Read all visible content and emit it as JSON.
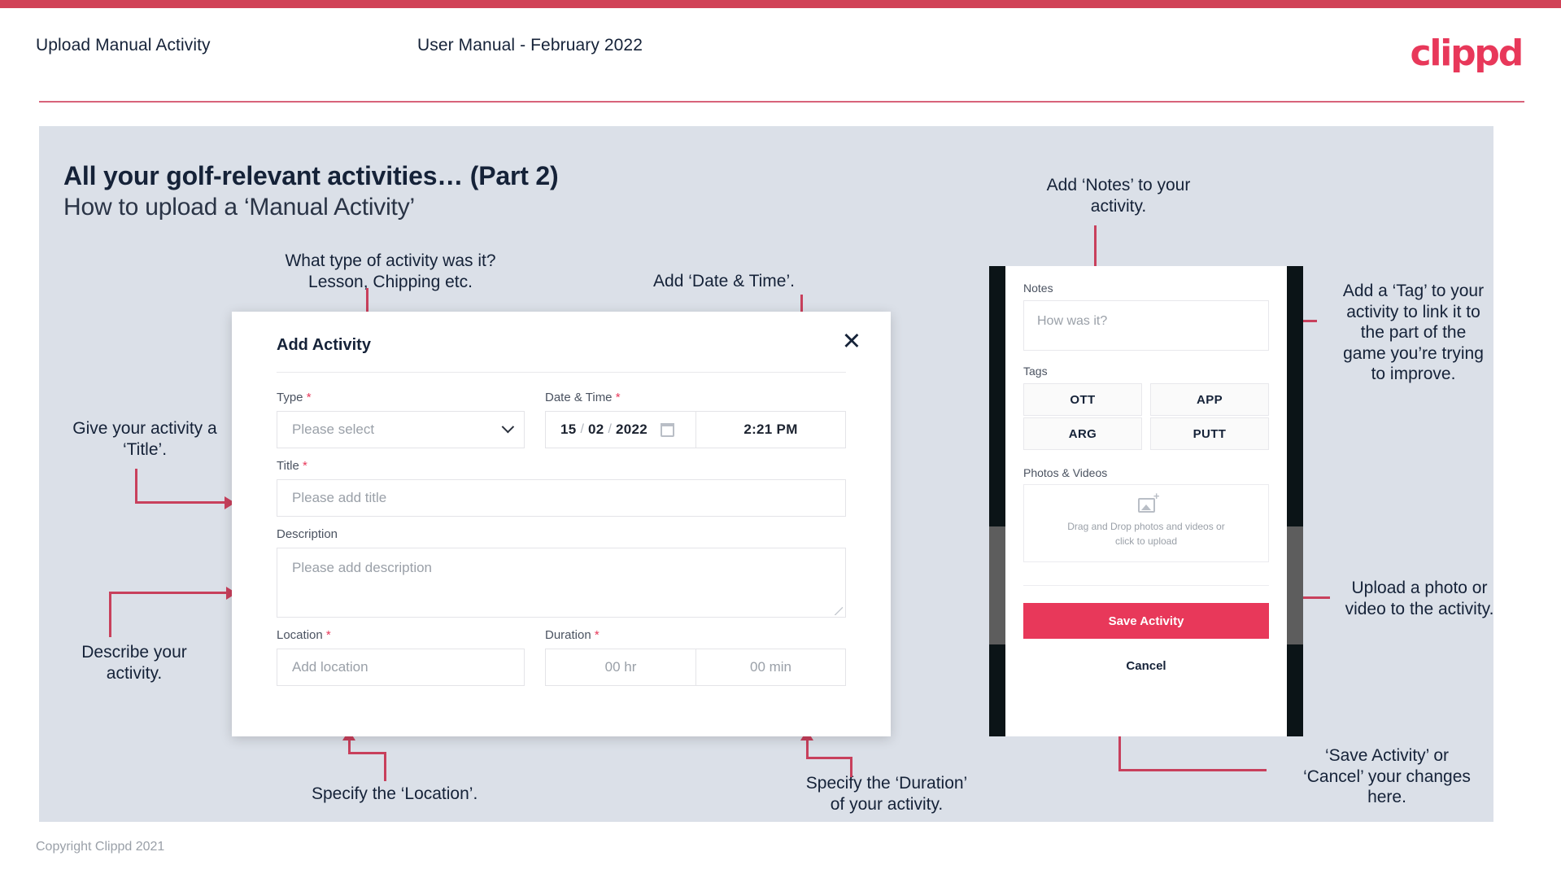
{
  "header": {
    "title": "Upload Manual Activity",
    "subtitle": "User Manual - February 2022",
    "logo": "clippd"
  },
  "slide": {
    "title": "All your golf-relevant activities… (Part 2)",
    "subtitle": "How to upload a ‘Manual Activity’"
  },
  "annotations": {
    "type": "What type of activity was it?\nLesson, Chipping etc.",
    "datetime": "Add ‘Date & Time’.",
    "title": "Give your activity a\n‘Title’.",
    "description": "Describe your\nactivity.",
    "location": "Specify the ‘Location’.",
    "duration": "Specify the ‘Duration’\nof your activity.",
    "notes": "Add ‘Notes’ to your\nactivity.",
    "tags": "Add a ‘Tag’ to your\nactivity to link it to\nthe part of the\ngame you’re trying\nto improve.",
    "upload": "Upload a photo or\nvideo to the activity.",
    "save": "‘Save Activity’ or\n‘Cancel’ your changes\nhere."
  },
  "modal": {
    "title": "Add Activity",
    "close_icon": "close-icon",
    "fields": {
      "type": {
        "label": "Type",
        "required": "*",
        "placeholder": "Please select"
      },
      "datetime": {
        "label": "Date & Time",
        "required": "*",
        "day": "15",
        "month": "02",
        "year": "2022",
        "separator": "/",
        "time": "2:21 PM"
      },
      "title": {
        "label": "Title",
        "required": "*",
        "placeholder": "Please add title"
      },
      "description": {
        "label": "Description",
        "placeholder": "Please add description"
      },
      "location": {
        "label": "Location",
        "required": "*",
        "placeholder": "Add location"
      },
      "duration": {
        "label": "Duration",
        "required": "*",
        "hours": "00 hr",
        "minutes": "00 min"
      }
    }
  },
  "phone": {
    "notes": {
      "label": "Notes",
      "placeholder": "How was it?"
    },
    "tags": {
      "label": "Tags",
      "items": [
        "OTT",
        "APP",
        "ARG",
        "PUTT"
      ]
    },
    "media": {
      "label": "Photos & Videos",
      "drop_line1": "Drag and Drop photos and videos or",
      "drop_line2": "click to upload"
    },
    "save_label": "Save Activity",
    "cancel_label": "Cancel"
  },
  "footer": {
    "copyright": "Copyright Clippd 2021"
  },
  "colors": {
    "accent": "#e8385a",
    "connector": "#c8405c",
    "top_bar": "#d14257",
    "panel_bg": "#dbe0e8",
    "text": "#152238"
  }
}
